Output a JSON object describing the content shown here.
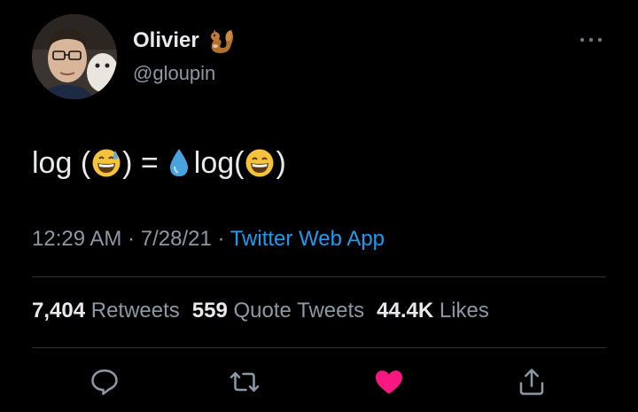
{
  "user": {
    "display_name": "Olivier",
    "name_badge_icon": "squirrel-icon",
    "handle": "@gloupin",
    "avatar_icon": "avatar-photo"
  },
  "tweet": {
    "parts": [
      {
        "type": "text",
        "value": "log ("
      },
      {
        "type": "emoji",
        "icon": "grinning-sweat-emoji"
      },
      {
        "type": "text",
        "value": ") ="
      },
      {
        "type": "emoji",
        "icon": "droplet-emoji"
      },
      {
        "type": "text",
        "value": "log("
      },
      {
        "type": "emoji",
        "icon": "grinning-smile-emoji"
      },
      {
        "type": "text",
        "value": ")"
      }
    ]
  },
  "meta": {
    "time": "12:29 AM",
    "sep1": " · ",
    "date": "7/28/21",
    "sep2": " · ",
    "source": "Twitter Web App"
  },
  "stats": {
    "retweets_count": "7,404",
    "retweets_label": "Retweets",
    "quotes_count": "559",
    "quotes_label": "Quote Tweets",
    "likes_count": "44.4K",
    "likes_label": "Likes"
  },
  "actions": [
    {
      "icon": "reply-icon"
    },
    {
      "icon": "retweet-icon"
    },
    {
      "icon": "heart-icon",
      "active": true,
      "color": "#f91880"
    },
    {
      "icon": "share-icon"
    }
  ],
  "colors": {
    "background": "#000000",
    "primary_text": "#e7e9ea",
    "secondary_text": "#8b98a5",
    "link": "#1d9bf0",
    "like": "#f91880"
  }
}
